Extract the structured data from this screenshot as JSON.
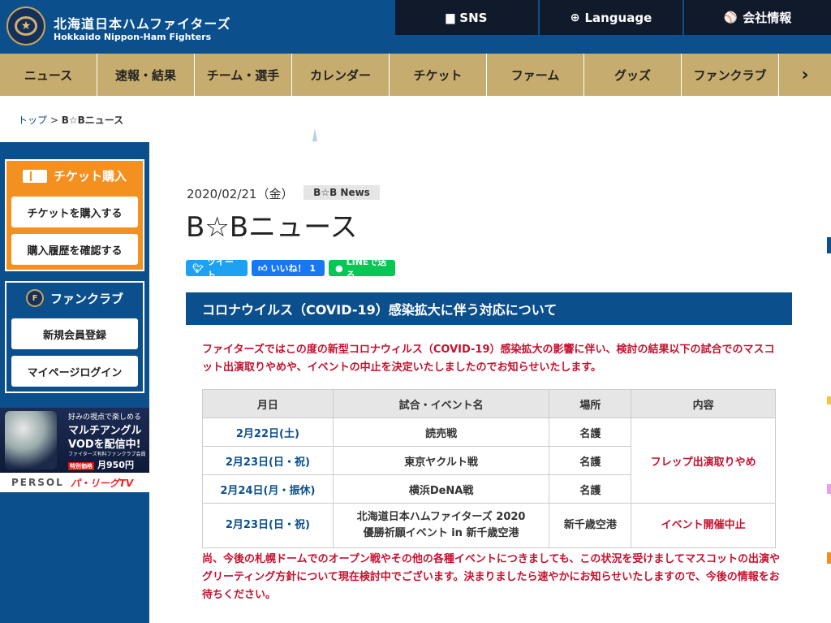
{
  "header": {
    "brand_ja": "北海道日本ハムファイターズ",
    "brand_en": "Hokkaido Nippon-Ham Fighters",
    "logo_text": "FIGHTERS",
    "sns_label": "SNS",
    "language_label": "Language",
    "company_label": "会社情報"
  },
  "nav": {
    "items": [
      "ニュース",
      "速報・結果",
      "チーム・選手",
      "カレンダー",
      "チケット",
      "ファーム",
      "グッズ",
      "ファンクラブ"
    ],
    "more": "›"
  },
  "breadcrumb": {
    "home": "トップ",
    "sep": ">",
    "current": "B☆Bニュース"
  },
  "sidebar": {
    "ticket_title": "チケット購入",
    "ticket_buy": "チケットを購入する",
    "ticket_history": "購入履歴を確認する",
    "fanclub_title": "ファンクラブ",
    "fanclub_register": "新規会員登録",
    "fanclub_login": "マイページログイン",
    "ad": {
      "line1": "好みの視点で楽しめる",
      "line2": "マルチアングル",
      "line3": "VODを配信中!",
      "line4": "ファイターズ有料ファンクラブ会員",
      "tag": "特別価格",
      "price": "月950円",
      "sponsor1": "PERSOL",
      "sponsor2": "パ・リーグTV"
    }
  },
  "article": {
    "date": "2020/02/21（金）",
    "category": "B☆B News",
    "title": "B☆Bニュース",
    "share": {
      "tweet": "ツイート",
      "like": "いいね！ 1",
      "line": "LINEで送る"
    },
    "heading": "コロナウイルス（COVID-19）感染拡大に伴う対応について",
    "intro": "ファイターズではこの度の新型コロナウィルス（COVID-19）感染拡大の影響に伴い、検討の結果以下の試合でのマスコット出演取りやめや、イベントの中止を決定いたしましたのでお知らせいたします。",
    "table": {
      "headers": [
        "月日",
        "試合・イベント名",
        "場所",
        "内容"
      ],
      "rows": [
        {
          "date": "2月22日(土)",
          "event": "読売戦",
          "place": "名護"
        },
        {
          "date": "2月23日(日・祝)",
          "event": "東京ヤクルト戦",
          "place": "名護"
        },
        {
          "date": "2月24日(月・振休)",
          "event": "横浜DeNA戦",
          "place": "名護"
        },
        {
          "date": "2月23日(日・祝)",
          "event_line1": "北海道日本ハムファイターズ 2020",
          "event_line2": "優勝祈願イベント in 新千歳空港",
          "place": "新千歳空港"
        }
      ],
      "content_merged": "フレップ出演取りやめ",
      "content_last": "イベント開催中止"
    },
    "note": "尚、今後の札幌ドームでのオープン戦やその他の各種イベントにつきましても、この状況を受けましてマスコットの出演やグリーティング方針について現在検討中でございます。決まりましたら速やかにお知らせいたしますので、今後の情報をお待ちください。"
  },
  "colors": {
    "brand_blue": "#0b4f8c",
    "nav_gold": "#c6ac6e",
    "ticket_orange": "#f39020",
    "alert_red": "#c8102e"
  }
}
